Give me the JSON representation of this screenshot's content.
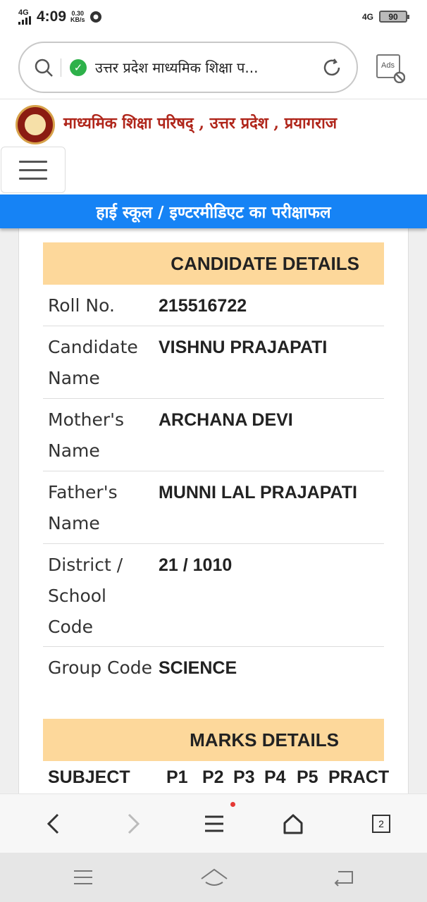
{
  "status_bar": {
    "network_left": "4G",
    "time": "4:09",
    "speed_value": "0.30",
    "speed_unit": "KB/s",
    "network_right": "4G",
    "battery": "90"
  },
  "browser": {
    "url_text": "उत्तर प्रदेश माध्यमिक शिक्षा प...",
    "ads_label": "Ads"
  },
  "site": {
    "title": "माध्यमिक शिक्षा परिषद् , उत्तर प्रदेश , प्रयागराज",
    "banner": "हाई स्कूल / इण्टरमीडिएट का परीक्षाफल"
  },
  "candidate_section": {
    "heading": "CANDIDATE DETAILS",
    "rows": [
      {
        "label": "Roll No.",
        "value": "215516722"
      },
      {
        "label": "Candidate Name",
        "value": "VISHNU PRAJAPATI"
      },
      {
        "label": "Mother's Name",
        "value": "ARCHANA DEVI"
      },
      {
        "label": "Father's Name",
        "value": "MUNNI LAL PRAJAPATI"
      },
      {
        "label": "District / School Code",
        "value": "21 / 1010"
      },
      {
        "label": "Group Code",
        "value": "SCIENCE"
      }
    ]
  },
  "marks_section": {
    "heading": "MARKS DETAILS",
    "columns": [
      "SUBJECT",
      "P1",
      "P2",
      "P3",
      "P4",
      "P5",
      "PRACT"
    ]
  },
  "toolbar": {
    "tab_count": "2"
  },
  "colors": {
    "banner": "#1683f5",
    "section_header": "#fdd89b",
    "site_title": "#b0261b",
    "secure_shield": "#2eb14a"
  }
}
